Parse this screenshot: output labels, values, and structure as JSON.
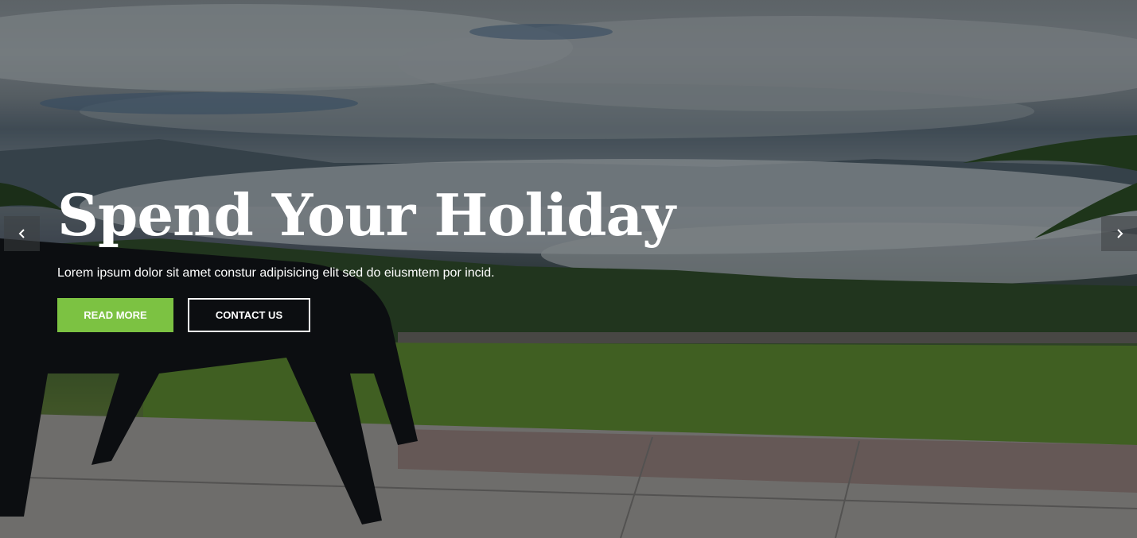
{
  "hero": {
    "title": "Spend Your Holiday",
    "subtitle": "Lorem ipsum dolor sit amet constur adipisicing elit sed do eiusmtem por incid.",
    "primary_button": "READ MORE",
    "secondary_button": "CONTACT US"
  },
  "slider": {
    "prev_icon": "chevron-left-icon",
    "next_icon": "chevron-right-icon"
  },
  "colors": {
    "accent": "#7cc242",
    "text": "#ffffff"
  }
}
